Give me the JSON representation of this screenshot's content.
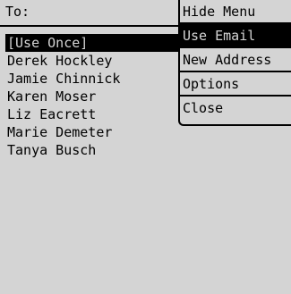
{
  "header": {
    "label": "To:"
  },
  "recipients": [
    {
      "label": "[Use Once]",
      "selected": true
    },
    {
      "label": "Derek Hockley",
      "selected": false
    },
    {
      "label": "Jamie Chinnick",
      "selected": false
    },
    {
      "label": "Karen Moser",
      "selected": false
    },
    {
      "label": "Liz Eacrett",
      "selected": false
    },
    {
      "label": "Marie Demeter",
      "selected": false
    },
    {
      "label": "Tanya Busch",
      "selected": false
    }
  ],
  "menu": {
    "items": [
      {
        "label": "Hide Menu",
        "selected": false
      },
      {
        "label": "Use Email",
        "selected": true
      },
      {
        "label": "New Address",
        "selected": false
      },
      {
        "label": "Options",
        "selected": false
      },
      {
        "label": "Close",
        "selected": false
      }
    ]
  }
}
